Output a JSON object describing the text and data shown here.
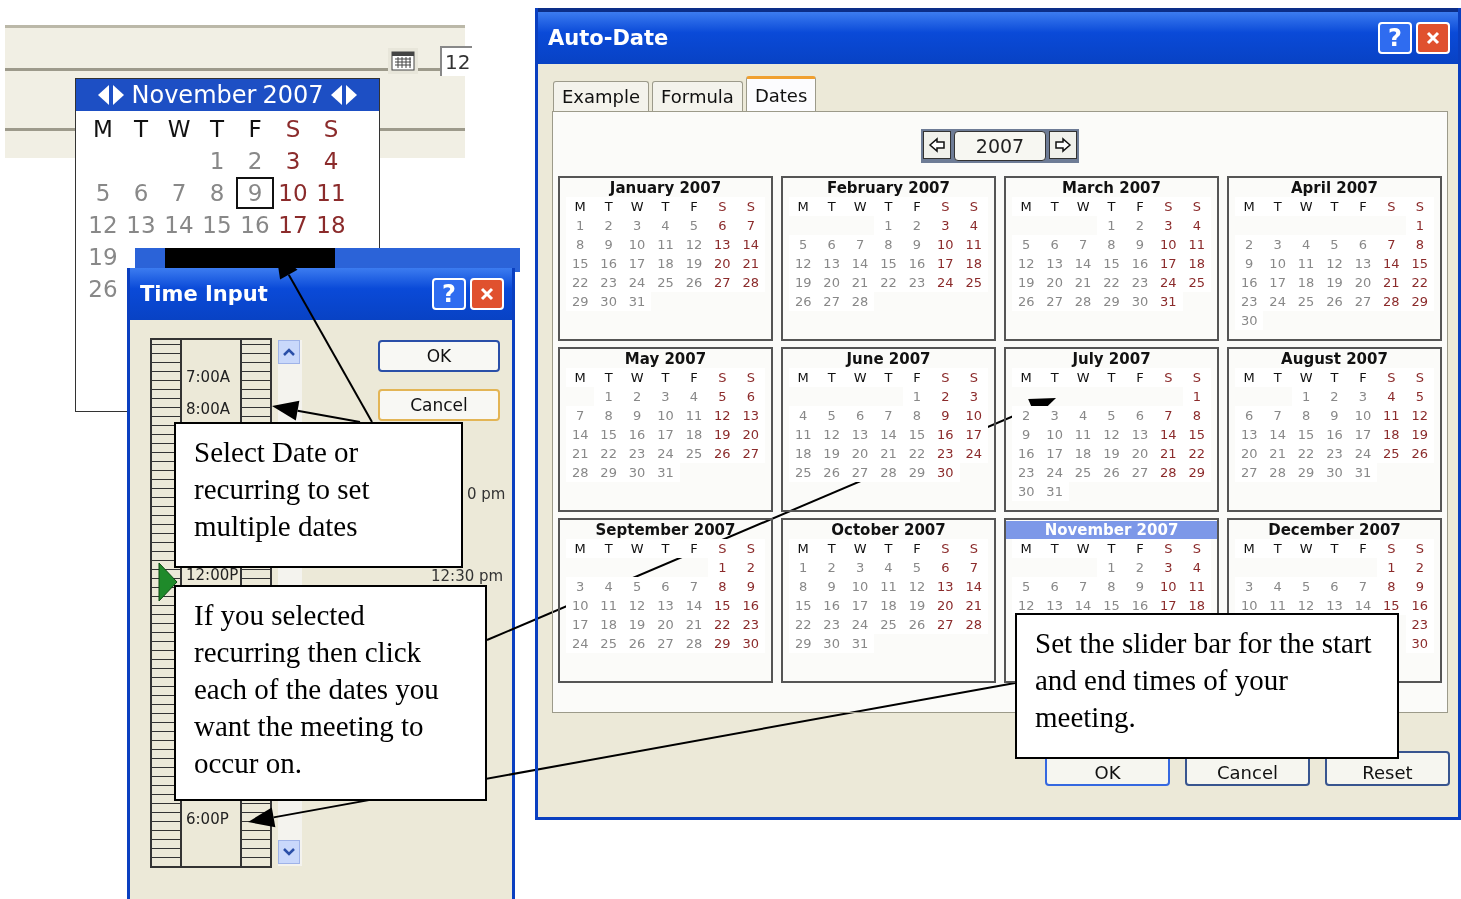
{
  "background_window": {
    "field_value": "12"
  },
  "date_popup": {
    "month": "November",
    "year": "2007",
    "weekdays": [
      "M",
      "T",
      "W",
      "T",
      "F",
      "S",
      "S"
    ],
    "weeks": [
      {
        "thu": {
          "day": "1",
          "selected": false
        },
        "fri": {
          "day": "2",
          "selected": false
        },
        "sat": {
          "day": "3",
          "selected": false
        },
        "sun": {
          "day": "4",
          "selected": false
        }
      },
      {
        "mon": {
          "day": "5",
          "selected": false
        },
        "tue": {
          "day": "6",
          "selected": false
        },
        "wed": {
          "day": "7",
          "selected": false
        },
        "thu": {
          "day": "8",
          "selected": false
        },
        "fri": {
          "day": "9",
          "selected": true
        },
        "sat": {
          "day": "10",
          "selected": false
        },
        "sun": {
          "day": "11",
          "selected": false
        }
      },
      {
        "mon": {
          "day": "12",
          "selected": false
        },
        "tue": {
          "day": "13",
          "selected": false
        },
        "wed": {
          "day": "14",
          "selected": false
        },
        "thu": {
          "day": "15",
          "selected": false
        },
        "fri": {
          "day": "16",
          "selected": false
        },
        "sat": {
          "day": "17",
          "selected": false
        },
        "sun": {
          "day": "18",
          "selected": false
        }
      },
      {
        "mon": {
          "day": "19",
          "selected": false
        }
      },
      {
        "mon": {
          "day": "26",
          "selected": false
        }
      }
    ]
  },
  "time_input": {
    "title": "Time Input",
    "help": "?",
    "ruler_labels": [
      "7:00A",
      "8:00A",
      "12:00P",
      "6:00P"
    ],
    "slider": {
      "level": 0.46
    },
    "side_labels": [
      "0 pm",
      "12:30 pm"
    ],
    "buttons": [
      "OK",
      "Cancel"
    ]
  },
  "auto_date": {
    "title": "Auto-Date",
    "help": "?",
    "tabs": [
      {
        "label": "Example",
        "selected": false
      },
      {
        "label": "Formula",
        "selected": false
      },
      {
        "label": "Dates",
        "selected": true
      }
    ],
    "year": "2007",
    "months": [
      {
        "title": "January 2007",
        "selected": false,
        "weekdays": [
          "M",
          "T",
          "W",
          "T",
          "F",
          "S",
          "S"
        ],
        "weeks": [
          {
            "mon": "1",
            "tue": "2",
            "wed": "3",
            "thu": "4",
            "fri": "5",
            "sat": "6",
            "sun": "7"
          },
          {
            "mon": "8",
            "tue": "9",
            "wed": "10",
            "thu": "11",
            "fri": "12",
            "sat": "13",
            "sun": "14"
          },
          {
            "mon": "15",
            "tue": "16",
            "wed": "17",
            "thu": "18",
            "fri": "19",
            "sat": "20",
            "sun": "21"
          },
          {
            "mon": "22",
            "tue": "23",
            "wed": "24",
            "thu": "25",
            "fri": "26",
            "sat": "27",
            "sun": "28"
          },
          {
            "mon": "29",
            "tue": "30",
            "wed": "31"
          }
        ]
      },
      {
        "title": "February 2007",
        "selected": false,
        "weekdays": [
          "M",
          "T",
          "W",
          "T",
          "F",
          "S",
          "S"
        ],
        "weeks": [
          {
            "thu": "1",
            "fri": "2",
            "sat": "3",
            "sun": "4"
          },
          {
            "mon": "5",
            "tue": "6",
            "wed": "7",
            "thu": "8",
            "fri": "9",
            "sat": "10",
            "sun": "11"
          },
          {
            "mon": "12",
            "tue": "13",
            "wed": "14",
            "thu": "15",
            "fri": "16",
            "sat": "17",
            "sun": "18"
          },
          {
            "mon": "19",
            "tue": "20",
            "wed": "21",
            "thu": "22",
            "fri": "23",
            "sat": "24",
            "sun": "25"
          },
          {
            "mon": "26",
            "tue": "27",
            "wed": "28"
          }
        ]
      },
      {
        "title": "March 2007",
        "selected": false,
        "weekdays": [
          "M",
          "T",
          "W",
          "T",
          "F",
          "S",
          "S"
        ],
        "weeks": [
          {
            "thu": "1",
            "fri": "2",
            "sat": "3",
            "sun": "4"
          },
          {
            "mon": "5",
            "tue": "6",
            "wed": "7",
            "thu": "8",
            "fri": "9",
            "sat": "10",
            "sun": "11"
          },
          {
            "mon": "12",
            "tue": "13",
            "wed": "14",
            "thu": "15",
            "fri": "16",
            "sat": "17",
            "sun": "18"
          },
          {
            "mon": "19",
            "tue": "20",
            "wed": "21",
            "thu": "22",
            "fri": "23",
            "sat": "24",
            "sun": "25"
          },
          {
            "mon": "26",
            "tue": "27",
            "wed": "28",
            "thu": "29",
            "fri": "30",
            "sat": "31"
          }
        ]
      },
      {
        "title": "April 2007",
        "selected": false,
        "weekdays": [
          "M",
          "T",
          "W",
          "T",
          "F",
          "S",
          "S"
        ],
        "weeks": [
          {
            "sun": "1"
          },
          {
            "mon": "2",
            "tue": "3",
            "wed": "4",
            "thu": "5",
            "fri": "6",
            "sat": "7",
            "sun": "8"
          },
          {
            "mon": "9",
            "tue": "10",
            "wed": "11",
            "thu": "12",
            "fri": "13",
            "sat": "14",
            "sun": "15"
          },
          {
            "mon": "16",
            "tue": "17",
            "wed": "18",
            "thu": "19",
            "fri": "20",
            "sat": "21",
            "sun": "22"
          },
          {
            "mon": "23",
            "tue": "24",
            "wed": "25",
            "thu": "26",
            "fri": "27",
            "sat": "28",
            "sun": "29"
          },
          {
            "mon": "30"
          }
        ]
      },
      {
        "title": "May 2007",
        "selected": false,
        "weekdays": [
          "M",
          "T",
          "W",
          "T",
          "F",
          "S",
          "S"
        ],
        "weeks": [
          {
            "tue": "1",
            "wed": "2",
            "thu": "3",
            "fri": "4",
            "sat": "5",
            "sun": "6"
          },
          {
            "mon": "7",
            "tue": "8",
            "wed": "9",
            "thu": "10",
            "fri": "11",
            "sat": "12",
            "sun": "13"
          },
          {
            "mon": "14",
            "tue": "15",
            "wed": "16",
            "thu": "17",
            "fri": "18",
            "sat": "19",
            "sun": "20"
          },
          {
            "mon": "21",
            "tue": "22",
            "wed": "23",
            "thu": "24",
            "fri": "25",
            "sat": "26",
            "sun": "27"
          },
          {
            "mon": "28",
            "tue": "29",
            "wed": "30",
            "thu": "31"
          }
        ]
      },
      {
        "title": "June 2007",
        "selected": false,
        "weekdays": [
          "M",
          "T",
          "W",
          "T",
          "F",
          "S",
          "S"
        ],
        "weeks": [
          {
            "fri": "1",
            "sat": "2",
            "sun": "3"
          },
          {
            "mon": "4",
            "tue": "5",
            "wed": "6",
            "thu": "7",
            "fri": "8",
            "sat": "9",
            "sun": "10"
          },
          {
            "mon": "11",
            "tue": "12",
            "wed": "13",
            "thu": "14",
            "fri": "15",
            "sat": "16",
            "sun": "17"
          },
          {
            "mon": "18",
            "tue": "19",
            "wed": "20",
            "thu": "21",
            "fri": "22",
            "sat": "23",
            "sun": "24"
          },
          {
            "mon": "25",
            "tue": "26",
            "wed": "27",
            "thu": "28",
            "fri": "29",
            "sat": "30"
          }
        ]
      },
      {
        "title": "July 2007",
        "selected": false,
        "weekdays": [
          "M",
          "T",
          "W",
          "T",
          "F",
          "S",
          "S"
        ],
        "weeks": [
          {
            "sun": "1"
          },
          {
            "mon": "2",
            "tue": "3",
            "wed": "4",
            "thu": "5",
            "fri": "6",
            "sat": "7",
            "sun": "8"
          },
          {
            "mon": "9",
            "tue": "10",
            "wed": "11",
            "thu": "12",
            "fri": "13",
            "sat": "14",
            "sun": "15"
          },
          {
            "mon": "16",
            "tue": "17",
            "wed": "18",
            "thu": "19",
            "fri": "20",
            "sat": "21",
            "sun": "22"
          },
          {
            "mon": "23",
            "tue": "24",
            "wed": "25",
            "thu": "26",
            "fri": "27",
            "sat": "28",
            "sun": "29"
          },
          {
            "mon": "30",
            "tue": "31"
          }
        ]
      },
      {
        "title": "August 2007",
        "selected": false,
        "weekdays": [
          "M",
          "T",
          "W",
          "T",
          "F",
          "S",
          "S"
        ],
        "weeks": [
          {
            "wed": "1",
            "thu": "2",
            "fri": "3",
            "sat": "4",
            "sun": "5"
          },
          {
            "mon": "6",
            "tue": "7",
            "wed": "8",
            "thu": "9",
            "fri": "10",
            "sat": "11",
            "sun": "12"
          },
          {
            "mon": "13",
            "tue": "14",
            "wed": "15",
            "thu": "16",
            "fri": "17",
            "sat": "18",
            "sun": "19"
          },
          {
            "mon": "20",
            "tue": "21",
            "wed": "22",
            "thu": "23",
            "fri": "24",
            "sat": "25",
            "sun": "26"
          },
          {
            "mon": "27",
            "tue": "28",
            "wed": "29",
            "thu": "30",
            "fri": "31"
          }
        ]
      },
      {
        "title": "September 2007",
        "selected": false,
        "weekdays": [
          "M",
          "T",
          "W",
          "T",
          "F",
          "S",
          "S"
        ],
        "weeks": [
          {
            "sat": "1",
            "sun": "2"
          },
          {
            "mon": "3",
            "tue": "4",
            "wed": "5",
            "thu": "6",
            "fri": "7",
            "sat": "8",
            "sun": "9"
          },
          {
            "mon": "10",
            "tue": "11",
            "wed": "12",
            "thu": "13",
            "fri": "14",
            "sat": "15",
            "sun": "16"
          },
          {
            "mon": "17",
            "tue": "18",
            "wed": "19",
            "thu": "20",
            "fri": "21",
            "sat": "22",
            "sun": "23"
          },
          {
            "mon": "24",
            "tue": "25",
            "wed": "26",
            "thu": "27",
            "fri": "28",
            "sat": "29",
            "sun": "30"
          }
        ]
      },
      {
        "title": "October 2007",
        "selected": false,
        "weekdays": [
          "M",
          "T",
          "W",
          "T",
          "F",
          "S",
          "S"
        ],
        "weeks": [
          {
            "mon": "1",
            "tue": "2",
            "wed": "3",
            "thu": "4",
            "fri": "5",
            "sat": "6",
            "sun": "7"
          },
          {
            "mon": "8",
            "tue": "9",
            "wed": "10",
            "thu": "11",
            "fri": "12",
            "sat": "13",
            "sun": "14"
          },
          {
            "mon": "15",
            "tue": "16",
            "wed": "17",
            "thu": "18",
            "fri": "19",
            "sat": "20",
            "sun": "21"
          },
          {
            "mon": "22",
            "tue": "23",
            "wed": "24",
            "thu": "25",
            "fri": "26",
            "sat": "27",
            "sun": "28"
          },
          {
            "mon": "29",
            "tue": "30",
            "wed": "31"
          }
        ]
      },
      {
        "title": "November 2007",
        "selected": true,
        "weekdays": [
          "M",
          "T",
          "W",
          "T",
          "F",
          "S",
          "S"
        ],
        "weeks": [
          {
            "thu": "1",
            "fri": "2",
            "sat": "3",
            "sun": "4"
          },
          {
            "mon": "5",
            "tue": "6",
            "wed": "7",
            "thu": "8",
            "fri": "9",
            "sat": "10",
            "sun": "11"
          },
          {
            "mon": "12",
            "tue": "13",
            "wed": "14",
            "thu": "15",
            "fri": "16",
            "sat": "17",
            "sun": "18"
          }
        ]
      },
      {
        "title": "December 2007",
        "selected": false,
        "weekdays": [
          "M",
          "T",
          "W",
          "T",
          "F",
          "S",
          "S"
        ],
        "weeks": [
          {
            "sat": "1",
            "sun": "2"
          },
          {
            "mon": "3",
            "tue": "4",
            "wed": "5",
            "thu": "6",
            "fri": "7",
            "sat": "8",
            "sun": "9"
          },
          {
            "mon": "10",
            "tue": "11",
            "wed": "12",
            "thu": "13",
            "fri": "14",
            "sat": "15",
            "sun": "16"
          },
          {
            "sun": "23"
          },
          {
            "sun": "30"
          }
        ]
      }
    ],
    "buttons": [
      "OK",
      "Cancel",
      "Reset"
    ]
  },
  "callouts": [
    "Select Date or recurring to set multiple dates",
    "If you selected recurring then click each of the dates you want the meeting to occur on.",
    "Set the slider bar for the start and end times of your meeting."
  ]
}
